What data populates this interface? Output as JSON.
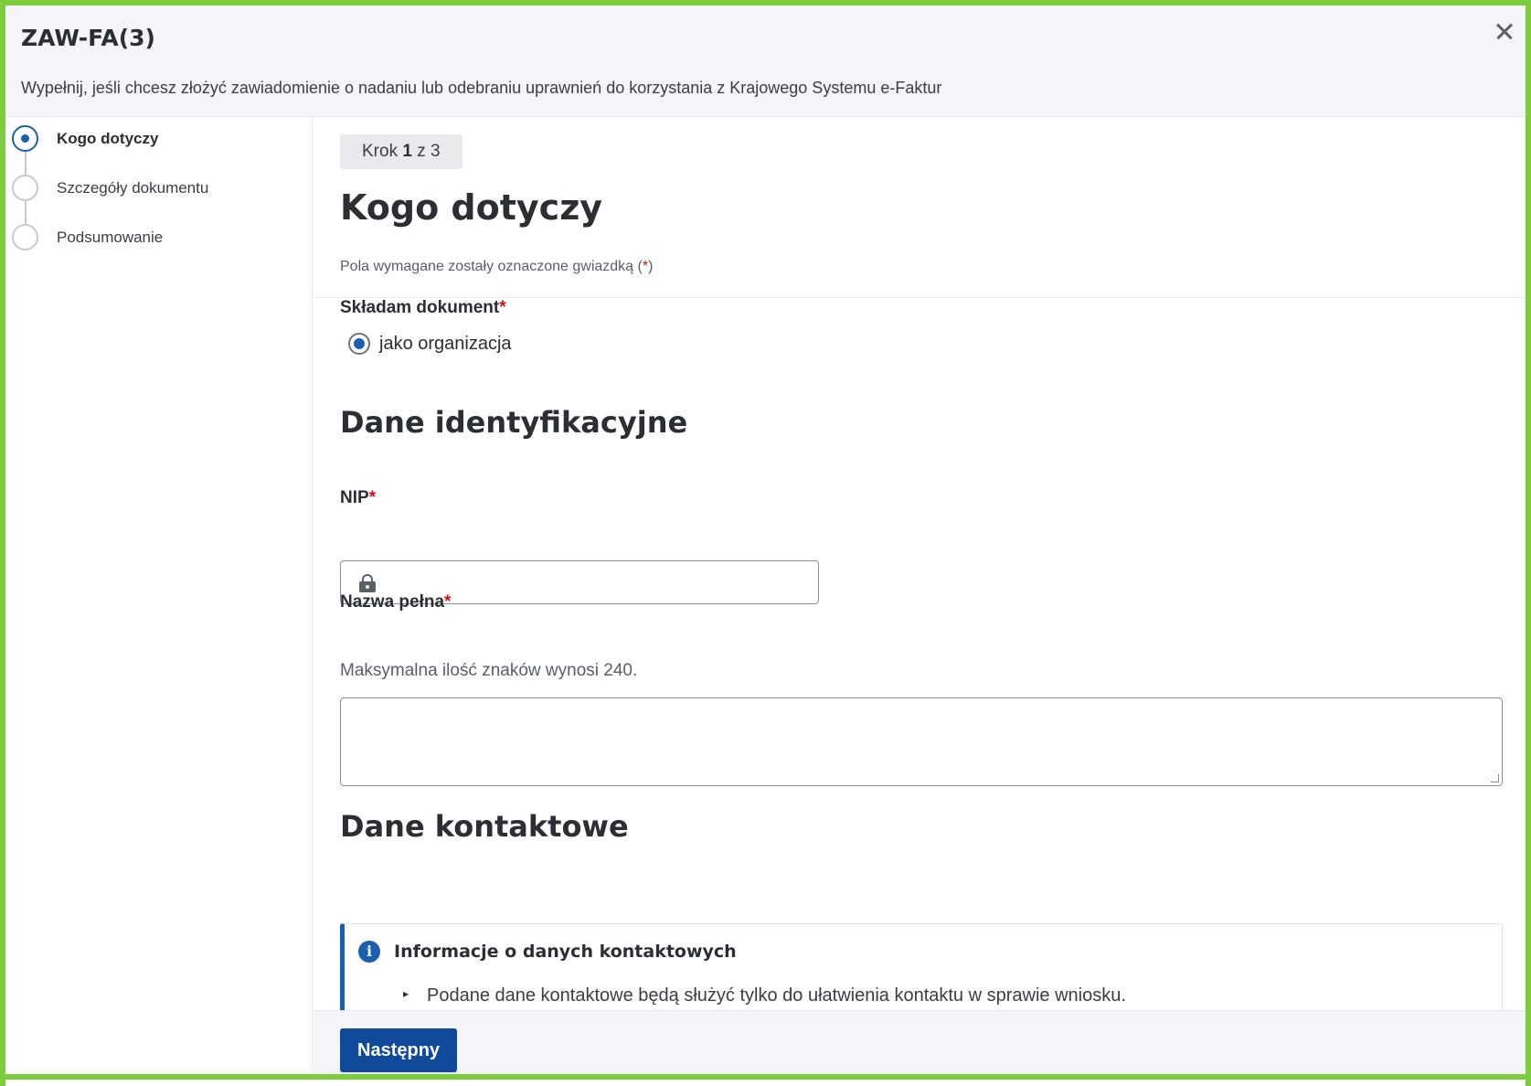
{
  "dialog": {
    "title": "ZAW-FA(3)",
    "description": "Wypełnij, jeśli chcesz złożyć zawiadomienie o nadaniu lub odebraniu uprawnień do korzystania z Krajowego Systemu e-Faktur",
    "close_icon": "close-icon"
  },
  "steps": [
    {
      "label": "Kogo dotyczy",
      "state": "active"
    },
    {
      "label": "Szczegóły dokumentu",
      "state": "pending"
    },
    {
      "label": "Podsumowanie",
      "state": "pending"
    }
  ],
  "main": {
    "step_prefix": "Krok ",
    "step_current": "1",
    "step_suffix": " z 3",
    "title": "Kogo dotyczy",
    "required_note_prefix": "Pola wymagane zostały oznaczone gwiazdką (",
    "required_star": "*",
    "required_note_suffix": ")",
    "filing_label": "Składam dokument",
    "filing_option": "jako organizacja",
    "section_identification": "Dane identyfikacyjne",
    "nip_label": "NIP",
    "nip_value": "",
    "name_label": "Nazwa pełna",
    "name_hint": "Maksymalna ilość znaków wynosi 240.",
    "name_value": "",
    "section_contact": "Dane kontaktowe",
    "info_title": "Informacje o danych kontaktowych",
    "info_bullet": "Podane dane kontaktowe będą służyć tylko do ułatwienia kontaktu w sprawie wniosku."
  },
  "footer": {
    "next_label": "Następny"
  },
  "colors": {
    "accent": "#1b5fb0",
    "button": "#114a9a",
    "required": "#c4161c",
    "frame": "#7ccc3b"
  }
}
